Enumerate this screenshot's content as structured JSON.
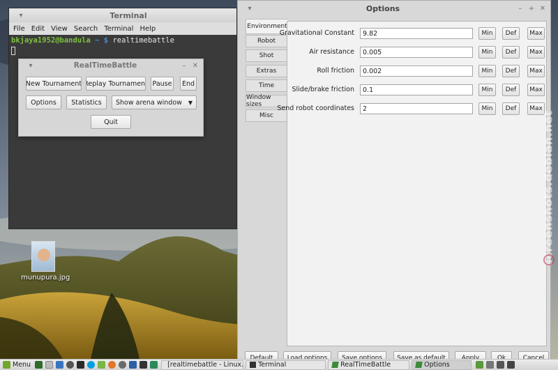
{
  "desktop": {
    "icon_label": "munupura.jpg",
    "watermark": "screenshots.debian.net"
  },
  "terminal": {
    "title": "Terminal",
    "menu": [
      "File",
      "Edit",
      "View",
      "Search",
      "Terminal",
      "Help"
    ],
    "prompt_user": "bkjaya1952@bandula",
    "prompt_path": "~",
    "prompt_symbol": "$",
    "command": "realtimebattle"
  },
  "rtb": {
    "title": "RealTimeBattle",
    "buttons": {
      "new_tournament": "New Tournament",
      "replay_tournament": "Replay Tournament",
      "pause": "Pause",
      "end": "End",
      "options": "Options",
      "statistics": "Statistics",
      "show_arena": "Show arena window",
      "quit": "Quit"
    }
  },
  "options": {
    "title": "Options",
    "tabs": [
      "Environment",
      "Robot",
      "Shot",
      "Extras",
      "Time",
      "Window sizes",
      "Misc"
    ],
    "rows": [
      {
        "label": "Gravitational Constant",
        "value": "9.82"
      },
      {
        "label": "Air resistance",
        "value": "0.005"
      },
      {
        "label": "Roll friction",
        "value": "0.002"
      },
      {
        "label": "Slide/brake friction",
        "value": "0.1"
      },
      {
        "label": "Send robot coordinates",
        "value": "2"
      }
    ],
    "row_buttons": {
      "min": "Min",
      "def": "Def",
      "max": "Max"
    },
    "bottom": {
      "default": "Default",
      "load": "Load options",
      "save": "Save options",
      "save_default": "Save as default",
      "apply": "Apply",
      "ok": "Ok",
      "cancel": "Cancel"
    }
  },
  "taskbar": {
    "menu_label": "Menu",
    "tasks": [
      "[realtimebattle - Linux...",
      "Terminal",
      "RealTimeBattle",
      "Options"
    ]
  }
}
